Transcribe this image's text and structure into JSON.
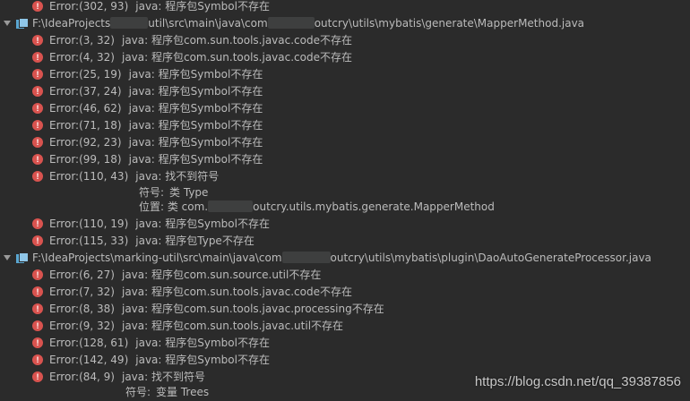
{
  "entries": {
    "e0": {
      "code": "Error:(302, 93)",
      "msg": "java: 程序包Symbol不存在"
    },
    "f1": {
      "path_a": "F:\\IdeaProjects",
      "path_b": "util\\src\\main\\java\\com",
      "path_c": "outcry\\utils\\mybatis\\generate\\MapperMethod.java"
    },
    "e1": {
      "code": "Error:(3, 32)",
      "msg": "java: 程序包com.sun.tools.javac.code不存在"
    },
    "e2": {
      "code": "Error:(4, 32)",
      "msg": "java: 程序包com.sun.tools.javac.code不存在"
    },
    "e3": {
      "code": "Error:(25, 19)",
      "msg": "java: 程序包Symbol不存在"
    },
    "e4": {
      "code": "Error:(37, 24)",
      "msg": "java: 程序包Symbol不存在"
    },
    "e5": {
      "code": "Error:(46, 62)",
      "msg": "java: 程序包Symbol不存在"
    },
    "e6": {
      "code": "Error:(71, 18)",
      "msg": "java: 程序包Symbol不存在"
    },
    "e7": {
      "code": "Error:(92, 23)",
      "msg": "java: 程序包Symbol不存在"
    },
    "e8": {
      "code": "Error:(99, 18)",
      "msg": "java: 程序包Symbol不存在"
    },
    "e9": {
      "code": "Error:(110, 43)",
      "msg": "java: 找不到符号"
    },
    "d1": {
      "label": "符号:",
      "value": "类 Type"
    },
    "d2": {
      "label": "位置: 类 com.",
      "value": "outcry.utils.mybatis.generate.MapperMethod"
    },
    "e10": {
      "code": "Error:(110, 19)",
      "msg": "java: 程序包Symbol不存在"
    },
    "e11": {
      "code": "Error:(115, 33)",
      "msg": "java: 程序包Type不存在"
    },
    "f2": {
      "path_a": "F:\\IdeaProjects\\marking-util\\src\\main\\java\\com",
      "path_c": "outcry\\utils\\mybatis\\plugin\\DaoAutoGenerateProcessor.java"
    },
    "e12": {
      "code": "Error:(6, 27)",
      "msg": "java: 程序包com.sun.source.util不存在"
    },
    "e13": {
      "code": "Error:(7, 32)",
      "msg": "java: 程序包com.sun.tools.javac.code不存在"
    },
    "e14": {
      "code": "Error:(8, 38)",
      "msg": "java: 程序包com.sun.tools.javac.processing不存在"
    },
    "e15": {
      "code": "Error:(9, 32)",
      "msg": "java: 程序包com.sun.tools.javac.util不存在"
    },
    "e16": {
      "code": "Error:(128, 61)",
      "msg": "java: 程序包Symbol不存在"
    },
    "e17": {
      "code": "Error:(142, 49)",
      "msg": "java: 程序包Symbol不存在"
    },
    "e18": {
      "code": "Error:(84, 9)",
      "msg": "java: 找不到符号"
    },
    "d3": {
      "label": "符号:",
      "value": "变量 Trees"
    }
  },
  "watermark": "https://blog.csdn.net/qq_39387856",
  "colors": {
    "background": "#2b2b2b",
    "text": "#bbbbbb",
    "error_icon": "#d9534f",
    "file_icon": "#5aa6d1"
  }
}
